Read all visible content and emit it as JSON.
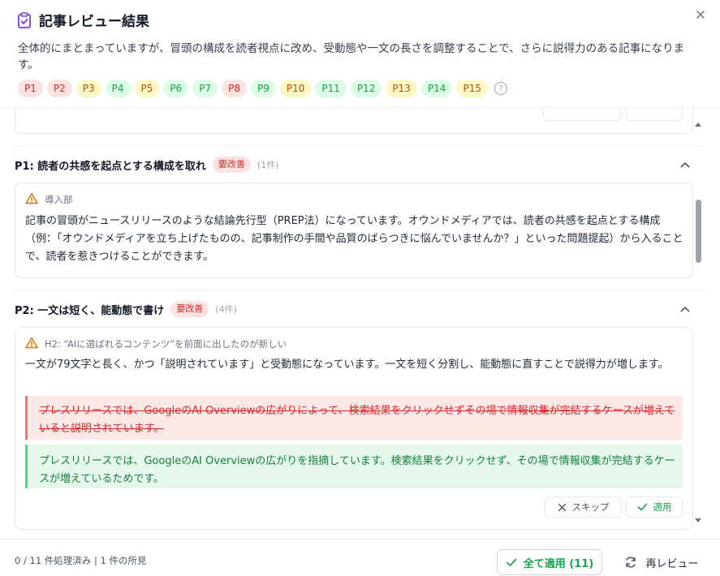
{
  "header": {
    "title": "記事レビュー結果",
    "summary": "全体的にまとまっていますが、冒頭の構成を読者視点に改め、受動態や一文の長さを調整することで、さらに説得力のある記事になります。",
    "help_symbol": "?"
  },
  "tags": [
    {
      "label": "P1",
      "status": "red"
    },
    {
      "label": "P2",
      "status": "red"
    },
    {
      "label": "P3",
      "status": "yellow"
    },
    {
      "label": "P4",
      "status": "green"
    },
    {
      "label": "P5",
      "status": "yellow"
    },
    {
      "label": "P6",
      "status": "green"
    },
    {
      "label": "P7",
      "status": "green"
    },
    {
      "label": "P8",
      "status": "red"
    },
    {
      "label": "P9",
      "status": "green"
    },
    {
      "label": "P10",
      "status": "yellow"
    },
    {
      "label": "P11",
      "status": "green"
    },
    {
      "label": "P12",
      "status": "green"
    },
    {
      "label": "P13",
      "status": "yellow"
    },
    {
      "label": "P14",
      "status": "green"
    },
    {
      "label": "P15",
      "status": "yellow"
    }
  ],
  "sections": {
    "p1": {
      "title": "P1: 読者の共感を起点とする構成を取れ",
      "badge": "要改善",
      "count": "(1件)",
      "location": "導入部",
      "text": "記事の冒頭がニュースリリースのような結論先行型（PREP法）になっています。オウンドメディアでは、読者の共感を起点とする構成（例：「オウンドメディアを立ち上げたものの、記事制作の手間や品質のばらつきに悩んでいませんか？」といった問題提起）から入ることで、読者を惹きつけることができます。"
    },
    "p2": {
      "title": "P2: 一文は短く、能動態で書け",
      "badge": "要改善",
      "count": "(4件)",
      "location": "H2: “AIに選ばれるコンテンツ”を前面に出したのが新しい",
      "text": "一文が79文字と長く、かつ「説明されています」と受動態になっています。一文を短く分割し、能動態に直すことで説得力が増します。",
      "deleted": "プレスリリースでは、GoogleのAI Overviewの広がりによって、検索結果をクリックせずその場で情報収集が完結するケースが増えていると説明されています。",
      "added": "プレスリリースでは、GoogleのAI Overviewの広がりを指摘しています。検索結果をクリックせず、その場で情報収集が完結するケースが増えているためです。",
      "skip_label": "スキップ",
      "apply_label": "適用"
    }
  },
  "footer": {
    "status": "0 / 11 件処理済み | 1 件の所見",
    "apply_all_label": "全て適用 (11)",
    "rereview_label": "再レビュー"
  },
  "colors": {
    "red_bg": "#fde2e2",
    "red_text": "#dc2626",
    "yellow_bg": "#fdf6c5",
    "yellow_text": "#b45309",
    "green_bg": "#dcfce7",
    "green_text": "#16a34a"
  },
  "icons": {
    "title": "clipboard-check-icon",
    "close": "close-icon",
    "help": "help-circle-icon",
    "warning": "warning-icon",
    "chevron": "chevron-up-icon",
    "skip": "x-icon",
    "apply": "check-icon",
    "rereview": "refresh-icon"
  }
}
